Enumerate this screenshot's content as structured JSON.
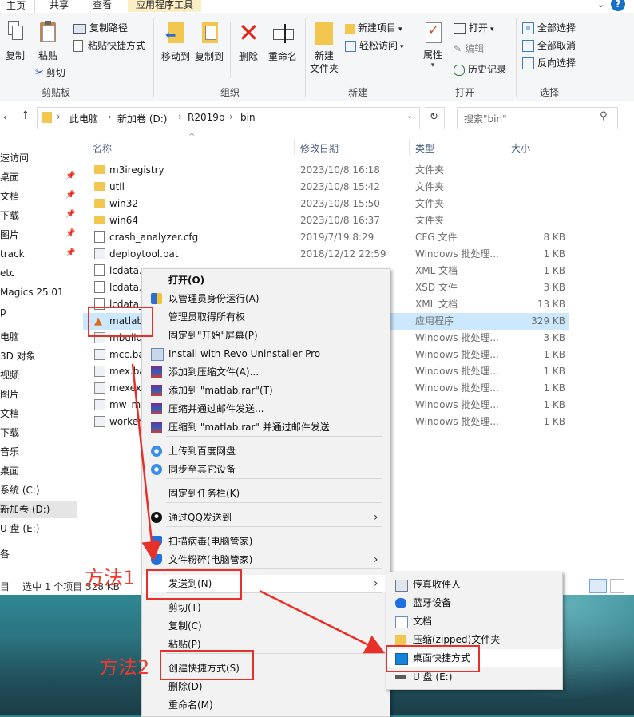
{
  "ribbon": {
    "tabs": [
      "主页",
      "共享",
      "查看",
      "应用程序工具"
    ],
    "clipboard": {
      "copy": "复制",
      "paste": "粘贴",
      "copy_path": "复制路径",
      "paste_shortcut": "粘贴快捷方式",
      "cut": "剪切",
      "group": "剪贴板"
    },
    "organize": {
      "move_to": "移动到",
      "copy_to": "复制到",
      "delete": "删除",
      "rename": "重命名",
      "group": "组织"
    },
    "new": {
      "new_folder_line1": "新建",
      "new_folder_line2": "文件夹",
      "new_item": "新建项目",
      "easy_access": "轻松访问",
      "group": "新建"
    },
    "open": {
      "properties": "属性",
      "open": "打开",
      "edit": "编辑",
      "history": "历史记录",
      "group": "打开"
    },
    "select": {
      "select_all": "全部选择",
      "select_none": "全部取消",
      "invert": "反向选择",
      "group": "选择"
    }
  },
  "address": {
    "breadcrumb": [
      "此电脑",
      "新加卷 (D:)",
      "R2019b",
      "bin"
    ],
    "search_placeholder": "搜索\"bin\""
  },
  "nav": {
    "items": [
      "速访问",
      "桌面",
      "文档",
      "下载",
      "图片",
      "track",
      "etc",
      "Magics 25.01",
      "p",
      "电脑",
      "3D 对象",
      "视频",
      "图片",
      "文档",
      "下载",
      "音乐",
      "桌面",
      "系统 (C:)",
      "新加卷 (D:)",
      "U 盘 (E:)",
      "各"
    ]
  },
  "columns": {
    "name": "名称",
    "modified": "修改日期",
    "type": "类型",
    "size": "大小"
  },
  "files": [
    {
      "name": "m3iregistry",
      "date": "2023/10/8 16:18",
      "type": "文件夹",
      "size": "",
      "icon": "folder"
    },
    {
      "name": "util",
      "date": "2023/10/8 15:42",
      "type": "文件夹",
      "size": "",
      "icon": "folder"
    },
    {
      "name": "win32",
      "date": "2023/10/8 15:50",
      "type": "文件夹",
      "size": "",
      "icon": "folder"
    },
    {
      "name": "win64",
      "date": "2023/10/8 16:37",
      "type": "文件夹",
      "size": "",
      "icon": "folder"
    },
    {
      "name": "crash_analyzer.cfg",
      "date": "2019/7/19 8:29",
      "type": "CFG 文件",
      "size": "8 KB",
      "icon": "file"
    },
    {
      "name": "deploytool.bat",
      "date": "2018/12/12 22:59",
      "type": "Windows 批处理...",
      "size": "1 KB",
      "icon": "bat"
    },
    {
      "name": "lcdata.",
      "date": "",
      "type": "XML 文档",
      "size": "1 KB",
      "icon": "file"
    },
    {
      "name": "lcdata.",
      "date": "",
      "type": "XSD 文件",
      "size": "3 KB",
      "icon": "file"
    },
    {
      "name": "lcdata_",
      "date": "",
      "type": "XML 文档",
      "size": "13 KB",
      "icon": "file"
    },
    {
      "name": "matlab.",
      "date": "",
      "type": "应用程序",
      "size": "329 KB",
      "icon": "matlab"
    },
    {
      "name": "mbuild",
      "date": "",
      "type": "Windows 批处理...",
      "size": "3 KB",
      "icon": "bat"
    },
    {
      "name": "mcc.ba",
      "date": "",
      "type": "Windows 批处理...",
      "size": "1 KB",
      "icon": "bat"
    },
    {
      "name": "mex.ba",
      "date": "",
      "type": "Windows 批处理...",
      "size": "1 KB",
      "icon": "bat"
    },
    {
      "name": "mexext",
      "date": "",
      "type": "Windows 批处理...",
      "size": "1 KB",
      "icon": "bat"
    },
    {
      "name": "mw_mp",
      "date": "",
      "type": "Windows 批处理...",
      "size": "1 KB",
      "icon": "bat"
    },
    {
      "name": "worker",
      "date": "",
      "type": "Windows 批处理...",
      "size": "1 KB",
      "icon": "bat"
    }
  ],
  "status": {
    "count": "目",
    "selected": "选中 1 个项目  328 KB"
  },
  "context_menu": {
    "items": [
      {
        "label": "打开(O)",
        "bold": true,
        "icon": ""
      },
      {
        "label": "以管理员身份运行(A)",
        "icon": "shield-icon"
      },
      {
        "label": "管理员取得所有权",
        "icon": ""
      },
      {
        "label": "固定到\"开始\"屏幕(P)",
        "icon": ""
      },
      {
        "label": "Install with Revo Uninstaller Pro",
        "icon": "revo-icon"
      },
      {
        "label": "添加到压缩文件(A)...",
        "icon": "winrar-icon"
      },
      {
        "label": "添加到 \"matlab.rar\"(T)",
        "icon": "winrar-icon"
      },
      {
        "label": "压缩并通过邮件发送...",
        "icon": "winrar-icon"
      },
      {
        "label": "压缩到 \"matlab.rar\" 并通过邮件发送",
        "icon": "winrar-icon"
      },
      {
        "label": "上传到百度网盘",
        "icon": "baidu-icon"
      },
      {
        "label": "同步至其它设备",
        "icon": "baidu-icon"
      },
      {
        "label": "固定到任务栏(K)",
        "icon": ""
      },
      {
        "label": "通过QQ发送到",
        "icon": "qq-icon"
      },
      {
        "label": "扫描病毒(电脑管家)",
        "icon": "tencent-shield-icon"
      },
      {
        "label": "文件粉碎(电脑管家)",
        "icon": "tencent-shield-icon"
      },
      {
        "label": "发送到(N)",
        "icon": ""
      },
      {
        "label": "剪切(T)",
        "icon": ""
      },
      {
        "label": "复制(C)",
        "icon": ""
      },
      {
        "label": "粘贴(P)",
        "icon": ""
      },
      {
        "label": "创建快捷方式(S)",
        "icon": ""
      },
      {
        "label": "删除(D)",
        "icon": ""
      },
      {
        "label": "重命名(M)",
        "icon": ""
      }
    ]
  },
  "send_to_menu": {
    "items": [
      {
        "label": "传真收件人",
        "icon": "fax-icon"
      },
      {
        "label": "蓝牙设备",
        "icon": "bluetooth-icon"
      },
      {
        "label": "文档",
        "icon": "document-icon"
      },
      {
        "label": "压缩(zipped)文件夹",
        "icon": "zip-folder-icon"
      },
      {
        "label": "桌面快捷方式",
        "icon": "desktop-icon"
      },
      {
        "label": "U 盘 (E:)",
        "icon": "usb-drive-icon"
      }
    ]
  },
  "annotations": {
    "method1": "方法1",
    "method2": "方法2"
  },
  "colors": {
    "accent": "#0078d7",
    "annotation_red": "#e8302a",
    "selected_row": "#cce8ff"
  }
}
